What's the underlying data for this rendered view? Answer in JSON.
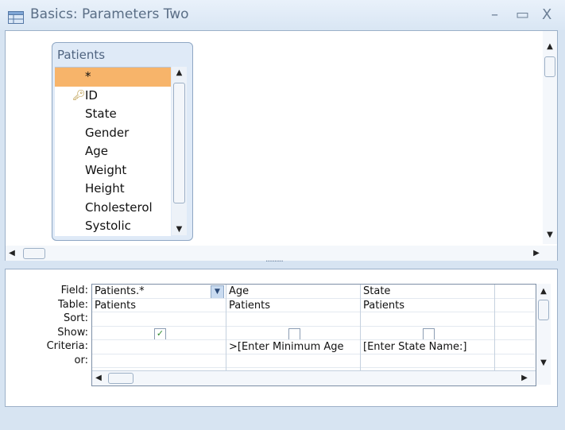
{
  "window": {
    "title": "Basics: Parameters Two",
    "minimize_glyph": "–",
    "maximize_glyph": "▭",
    "close_glyph": "X"
  },
  "table_box": {
    "title": "Patients",
    "fields": [
      "*",
      "ID",
      "State",
      "Gender",
      "Age",
      "Weight",
      "Height",
      "Cholesterol",
      "Systolic"
    ],
    "selected_field": "*",
    "key_field": "ID"
  },
  "grid": {
    "row_labels": {
      "field": "Field:",
      "table": "Table:",
      "sort": "Sort:",
      "show": "Show:",
      "criteria": "Criteria:",
      "or": "or:"
    },
    "columns": [
      {
        "field": "Patients.*",
        "table": "Patients",
        "sort": "",
        "show": true,
        "criteria": "",
        "or": ""
      },
      {
        "field": "Age",
        "table": "Patients",
        "sort": "",
        "show": false,
        "criteria": ">[Enter Minimum Age",
        "or": ""
      },
      {
        "field": "State",
        "table": "Patients",
        "sort": "",
        "show": false,
        "criteria": "[Enter State Name:]",
        "or": ""
      }
    ]
  },
  "colors": {
    "selected_row": "#f7b46a",
    "pane_background": "#d7e4f2",
    "title_text": "#5a6e86"
  },
  "icons": {
    "app": "query-design-icon",
    "key": "primary-key-icon",
    "dropdown": "chevron-down-icon",
    "check": "checkmark-icon"
  }
}
